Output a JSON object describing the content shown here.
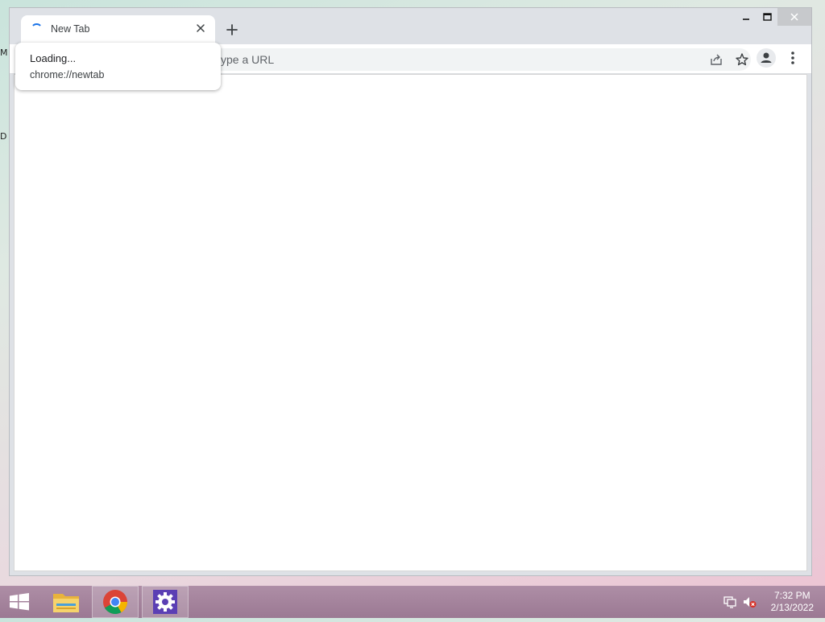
{
  "desktop": {
    "edge_texts": [
      "M",
      "D"
    ]
  },
  "browser": {
    "tab": {
      "title": "New Tab",
      "icon": "loading-spinner-icon",
      "close_icon": "close-icon"
    },
    "new_tab_icon": "plus-icon",
    "window_controls": [
      "minimize-icon",
      "maximize-icon",
      "close-icon"
    ],
    "omnibox": {
      "visible_text": "ype a URL",
      "actions": [
        "share-icon",
        "bookmark-star-icon"
      ]
    },
    "profile_icon": "profile-icon",
    "menu_icon": "more-vert-icon",
    "tooltip": {
      "title": "Loading...",
      "url": "chrome://newtab"
    },
    "accent_color": "#1a73e8"
  },
  "taskbar": {
    "pinned": [
      "windows-start-icon",
      "file-explorer-icon",
      "chrome-icon",
      "settings-icon"
    ],
    "tray_icons": [
      "network-icon",
      "volume-muted-icon"
    ],
    "clock": {
      "time": "7:32 PM",
      "date": "2/13/2022"
    }
  }
}
